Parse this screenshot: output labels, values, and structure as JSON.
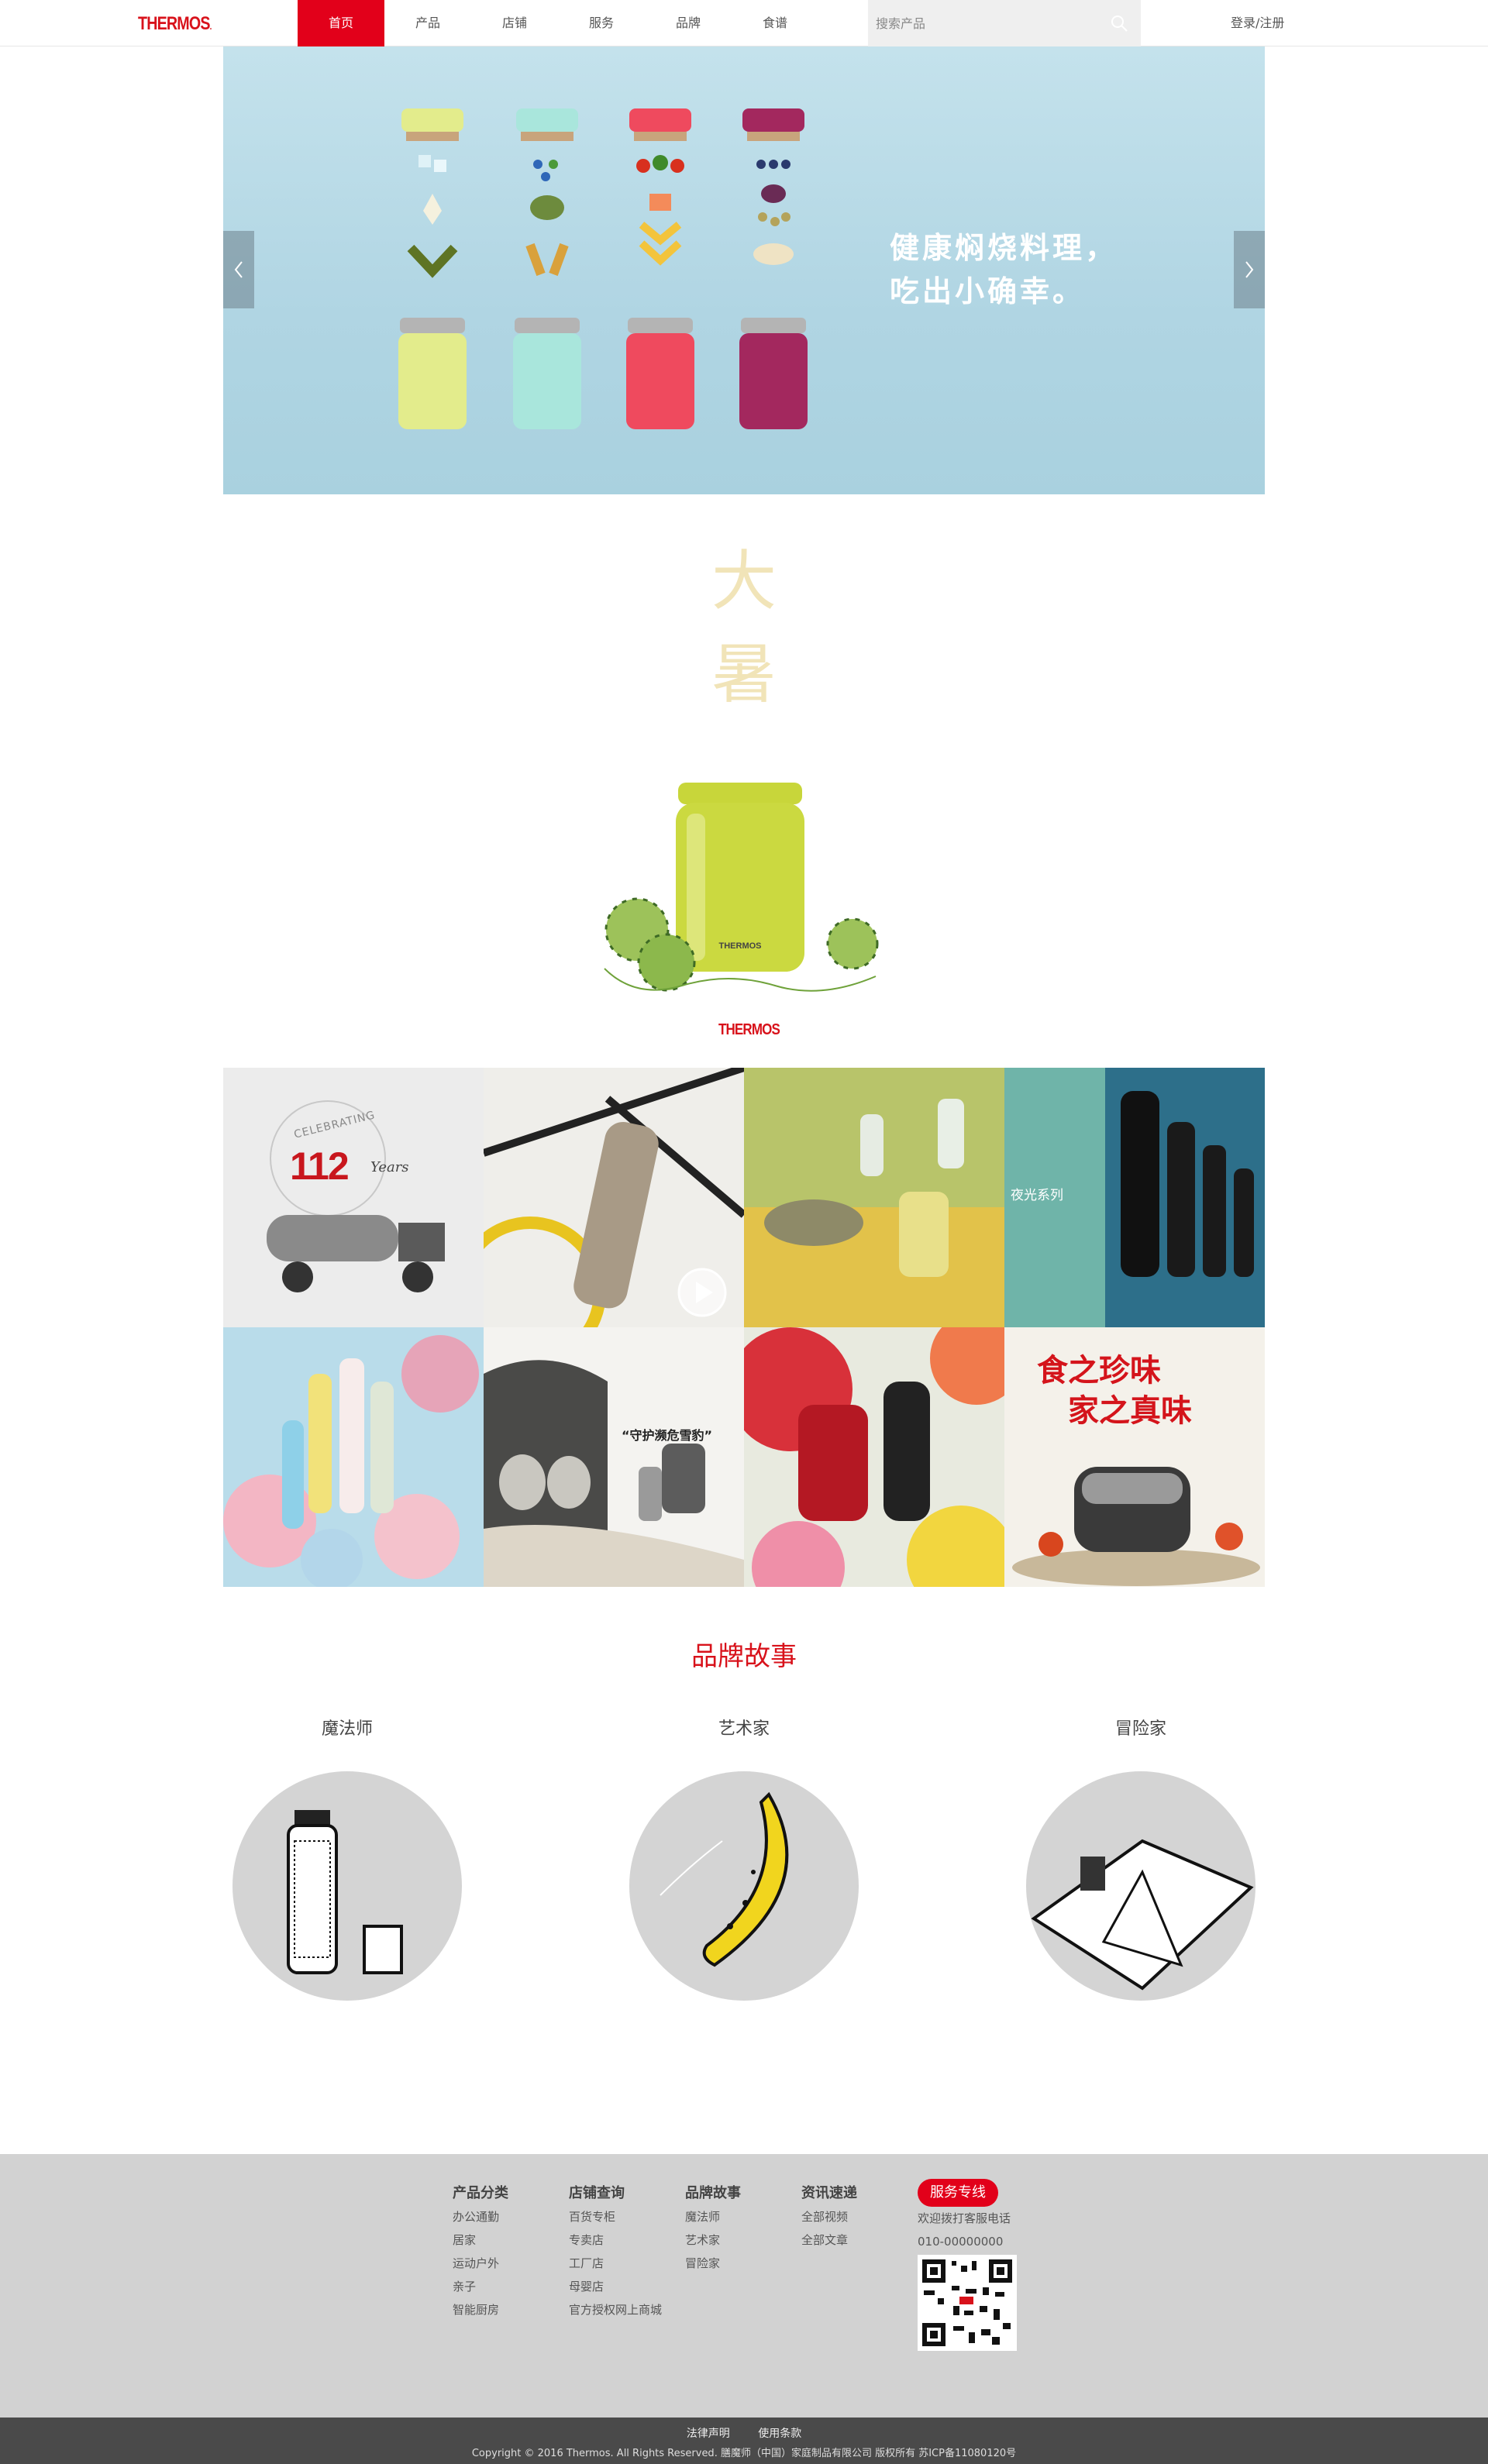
{
  "header": {
    "logo": "THERMOS",
    "nav": [
      "首页",
      "产品",
      "店铺",
      "服务",
      "品牌",
      "食谱"
    ],
    "active_index": 0,
    "search_placeholder": "搜索产品",
    "login": "登录/注册"
  },
  "hero": {
    "line1": "健康焖烧料理，",
    "line2": "吃出小确幸。",
    "jar_colors": [
      "#e3ec8c",
      "#a9e6dc",
      "#ef4a5e",
      "#a3285e"
    ]
  },
  "promo": {
    "calligraphy": [
      "大",
      "暑"
    ],
    "logo": "THERMOS"
  },
  "tiles": {
    "celebrating": "CELEBRATING",
    "celebrating_num": "112",
    "celebrating_years": "Years",
    "night_series": "夜光系列",
    "snow_leopard": "“守护濒危雪豹”",
    "delicacy": [
      "食之珍味",
      "家之真味"
    ]
  },
  "brand_story": {
    "title": "品牌故事",
    "items": [
      "魔法师",
      "艺术家",
      "冒险家"
    ]
  },
  "footer": {
    "columns": [
      {
        "title": "产品分类",
        "links": [
          "办公通勤",
          "居家",
          "运动户外",
          "亲子",
          "智能厨房"
        ]
      },
      {
        "title": "店铺查询",
        "links": [
          "百货专柜",
          "专卖店",
          "工厂店",
          "母婴店",
          "官方授权网上商城"
        ]
      },
      {
        "title": "品牌故事",
        "links": [
          "魔法师",
          "艺术家",
          "冒险家"
        ]
      },
      {
        "title": "资讯速递",
        "links": [
          "全部视频",
          "全部文章"
        ]
      }
    ],
    "hotline_badge": "服务专线",
    "hotline_text": "欢迎拨打客服电话",
    "hotline_number": "010-00000000",
    "legal_links": [
      "法律声明",
      "使用条款"
    ],
    "copyright": "Copyright © 2016 Thermos. All Rights Reserved. 膳魔师（中国）家庭制品有限公司 版权所有 苏ICP备11080120号"
  },
  "colors": {
    "brand_red": "#e2001a",
    "footer_bg": "#d2d2d2",
    "bottom_bar": "#4a4a4a"
  }
}
